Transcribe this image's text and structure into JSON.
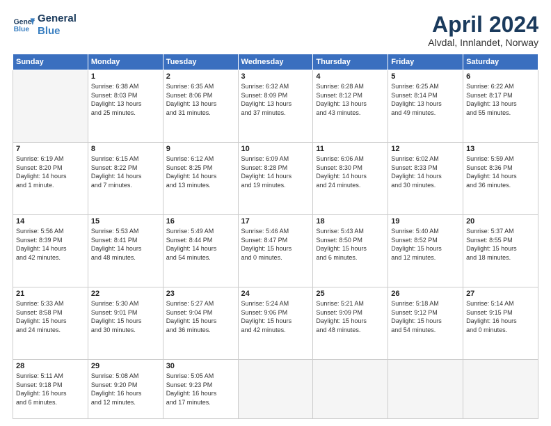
{
  "header": {
    "logo_line1": "General",
    "logo_line2": "Blue",
    "title": "April 2024",
    "subtitle": "Alvdal, Innlandet, Norway"
  },
  "calendar": {
    "days_of_week": [
      "Sunday",
      "Monday",
      "Tuesday",
      "Wednesday",
      "Thursday",
      "Friday",
      "Saturday"
    ],
    "weeks": [
      [
        {
          "num": "",
          "info": ""
        },
        {
          "num": "1",
          "info": "Sunrise: 6:38 AM\nSunset: 8:03 PM\nDaylight: 13 hours\nand 25 minutes."
        },
        {
          "num": "2",
          "info": "Sunrise: 6:35 AM\nSunset: 8:06 PM\nDaylight: 13 hours\nand 31 minutes."
        },
        {
          "num": "3",
          "info": "Sunrise: 6:32 AM\nSunset: 8:09 PM\nDaylight: 13 hours\nand 37 minutes."
        },
        {
          "num": "4",
          "info": "Sunrise: 6:28 AM\nSunset: 8:12 PM\nDaylight: 13 hours\nand 43 minutes."
        },
        {
          "num": "5",
          "info": "Sunrise: 6:25 AM\nSunset: 8:14 PM\nDaylight: 13 hours\nand 49 minutes."
        },
        {
          "num": "6",
          "info": "Sunrise: 6:22 AM\nSunset: 8:17 PM\nDaylight: 13 hours\nand 55 minutes."
        }
      ],
      [
        {
          "num": "7",
          "info": "Sunrise: 6:19 AM\nSunset: 8:20 PM\nDaylight: 14 hours\nand 1 minute."
        },
        {
          "num": "8",
          "info": "Sunrise: 6:15 AM\nSunset: 8:22 PM\nDaylight: 14 hours\nand 7 minutes."
        },
        {
          "num": "9",
          "info": "Sunrise: 6:12 AM\nSunset: 8:25 PM\nDaylight: 14 hours\nand 13 minutes."
        },
        {
          "num": "10",
          "info": "Sunrise: 6:09 AM\nSunset: 8:28 PM\nDaylight: 14 hours\nand 19 minutes."
        },
        {
          "num": "11",
          "info": "Sunrise: 6:06 AM\nSunset: 8:30 PM\nDaylight: 14 hours\nand 24 minutes."
        },
        {
          "num": "12",
          "info": "Sunrise: 6:02 AM\nSunset: 8:33 PM\nDaylight: 14 hours\nand 30 minutes."
        },
        {
          "num": "13",
          "info": "Sunrise: 5:59 AM\nSunset: 8:36 PM\nDaylight: 14 hours\nand 36 minutes."
        }
      ],
      [
        {
          "num": "14",
          "info": "Sunrise: 5:56 AM\nSunset: 8:39 PM\nDaylight: 14 hours\nand 42 minutes."
        },
        {
          "num": "15",
          "info": "Sunrise: 5:53 AM\nSunset: 8:41 PM\nDaylight: 14 hours\nand 48 minutes."
        },
        {
          "num": "16",
          "info": "Sunrise: 5:49 AM\nSunset: 8:44 PM\nDaylight: 14 hours\nand 54 minutes."
        },
        {
          "num": "17",
          "info": "Sunrise: 5:46 AM\nSunset: 8:47 PM\nDaylight: 15 hours\nand 0 minutes."
        },
        {
          "num": "18",
          "info": "Sunrise: 5:43 AM\nSunset: 8:50 PM\nDaylight: 15 hours\nand 6 minutes."
        },
        {
          "num": "19",
          "info": "Sunrise: 5:40 AM\nSunset: 8:52 PM\nDaylight: 15 hours\nand 12 minutes."
        },
        {
          "num": "20",
          "info": "Sunrise: 5:37 AM\nSunset: 8:55 PM\nDaylight: 15 hours\nand 18 minutes."
        }
      ],
      [
        {
          "num": "21",
          "info": "Sunrise: 5:33 AM\nSunset: 8:58 PM\nDaylight: 15 hours\nand 24 minutes."
        },
        {
          "num": "22",
          "info": "Sunrise: 5:30 AM\nSunset: 9:01 PM\nDaylight: 15 hours\nand 30 minutes."
        },
        {
          "num": "23",
          "info": "Sunrise: 5:27 AM\nSunset: 9:04 PM\nDaylight: 15 hours\nand 36 minutes."
        },
        {
          "num": "24",
          "info": "Sunrise: 5:24 AM\nSunset: 9:06 PM\nDaylight: 15 hours\nand 42 minutes."
        },
        {
          "num": "25",
          "info": "Sunrise: 5:21 AM\nSunset: 9:09 PM\nDaylight: 15 hours\nand 48 minutes."
        },
        {
          "num": "26",
          "info": "Sunrise: 5:18 AM\nSunset: 9:12 PM\nDaylight: 15 hours\nand 54 minutes."
        },
        {
          "num": "27",
          "info": "Sunrise: 5:14 AM\nSunset: 9:15 PM\nDaylight: 16 hours\nand 0 minutes."
        }
      ],
      [
        {
          "num": "28",
          "info": "Sunrise: 5:11 AM\nSunset: 9:18 PM\nDaylight: 16 hours\nand 6 minutes."
        },
        {
          "num": "29",
          "info": "Sunrise: 5:08 AM\nSunset: 9:20 PM\nDaylight: 16 hours\nand 12 minutes."
        },
        {
          "num": "30",
          "info": "Sunrise: 5:05 AM\nSunset: 9:23 PM\nDaylight: 16 hours\nand 17 minutes."
        },
        {
          "num": "",
          "info": ""
        },
        {
          "num": "",
          "info": ""
        },
        {
          "num": "",
          "info": ""
        },
        {
          "num": "",
          "info": ""
        }
      ]
    ]
  }
}
